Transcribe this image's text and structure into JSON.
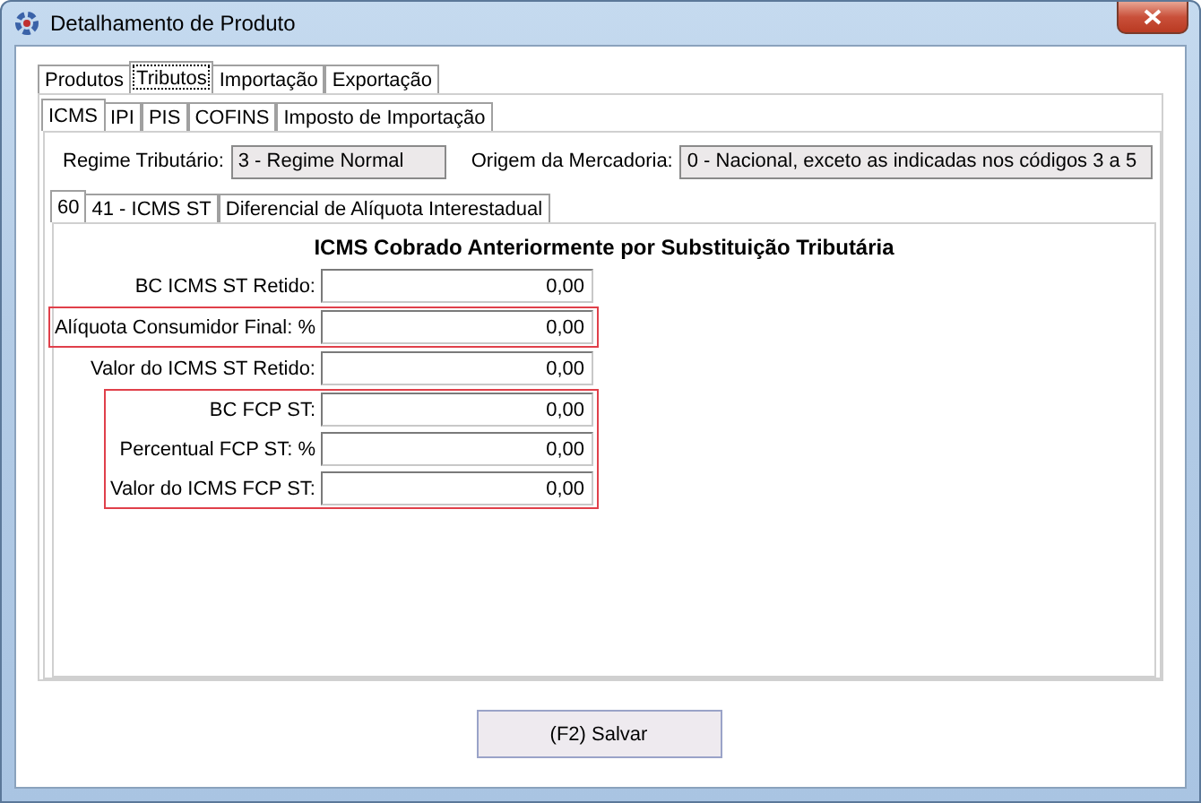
{
  "window": {
    "title": "Detalhamento de Produto"
  },
  "main_tabs": [
    {
      "label": "Produtos",
      "selected": false,
      "focused": false
    },
    {
      "label": "Tributos",
      "selected": true,
      "focused": true
    },
    {
      "label": "Importação",
      "selected": false,
      "focused": false
    },
    {
      "label": "Exportação",
      "selected": false,
      "focused": false
    }
  ],
  "tax_tabs": [
    {
      "label": "ICMS",
      "selected": true
    },
    {
      "label": "IPI",
      "selected": false
    },
    {
      "label": "PIS",
      "selected": false
    },
    {
      "label": "COFINS",
      "selected": false
    },
    {
      "label": "Imposto de Importação",
      "selected": false
    }
  ],
  "regime": {
    "label": "Regime Tributário:",
    "value": "3 - Regime Normal"
  },
  "origem": {
    "label": "Origem da Mercadoria:",
    "value": "0 - Nacional, exceto as indicadas nos códigos 3 a 5"
  },
  "cst_tabs": [
    {
      "label": "60",
      "selected": true
    },
    {
      "label": "41 - ICMS ST",
      "selected": false
    },
    {
      "label": "Diferencial de Alíquota Interestadual",
      "selected": false
    }
  ],
  "section_title": "ICMS Cobrado Anteriormente por Substituição Tributária",
  "field_groups": [
    {
      "highlighted": false,
      "fields": [
        {
          "label": "BC ICMS ST Retido:",
          "value": "0,00"
        }
      ]
    },
    {
      "highlighted": true,
      "fields": [
        {
          "label": "Alíquota Consumidor Final: %",
          "value": "0,00"
        }
      ]
    },
    {
      "highlighted": false,
      "fields": [
        {
          "label": "Valor do ICMS ST Retido:",
          "value": "0,00"
        }
      ]
    },
    {
      "highlighted": true,
      "fields": [
        {
          "label": "BC FCP ST:",
          "value": "0,00"
        },
        {
          "label": "Percentual FCP ST: %",
          "value": "0,00"
        },
        {
          "label": "Valor do ICMS FCP ST:",
          "value": "0,00"
        }
      ]
    }
  ],
  "buttons": [
    {
      "label": "(F2) Salvar"
    }
  ]
}
